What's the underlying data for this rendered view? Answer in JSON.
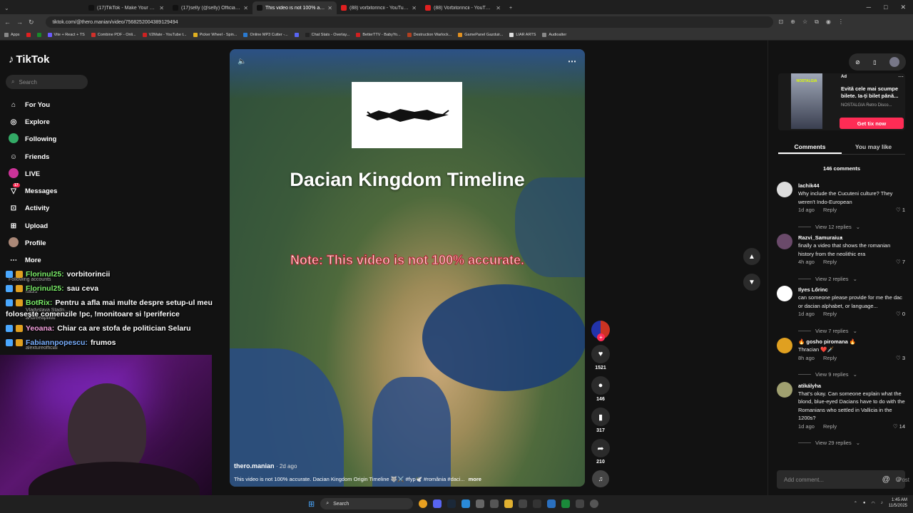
{
  "browser": {
    "tabs": [
      {
        "title": "(17)TikTok - Make Your Day",
        "color": "#111111"
      },
      {
        "title": "(17)selly (@selly) Official | TikTok",
        "color": "#111111"
      },
      {
        "title": "This video is not 100% accu...",
        "color": "#111111",
        "active": true
      },
      {
        "title": "(88) vorbitorincii - YouTube",
        "color": "#e02020"
      },
      {
        "title": "(88) Vorbitorincii - YouTube",
        "color": "#e02020"
      }
    ],
    "new_tab": "+",
    "url": "tiktok.com/@thero.manian/video/7568252004389129494",
    "bookmarks": [
      {
        "label": "Apps",
        "color": "#888888"
      },
      {
        "label": "",
        "color": "#e02020"
      },
      {
        "label": "",
        "color": "#1a8a2a"
      },
      {
        "label": "Vite + React + TS",
        "color": "#6b5bff"
      },
      {
        "label": "Combine PDF - Onli...",
        "color": "#d0302a"
      },
      {
        "label": "V2Mate - YouTube t...",
        "color": "#cc2222"
      },
      {
        "label": "Picker Wheel - Spin...",
        "color": "#e0b020"
      },
      {
        "label": "Online MP3 Cutter -...",
        "color": "#2a7ad0"
      },
      {
        "label": "",
        "color": "#5865f2"
      },
      {
        "label": "Chat Stats - Overlay...",
        "color": "#222222"
      },
      {
        "label": "BetterTTV - BabyYo...",
        "color": "#d02020"
      },
      {
        "label": "Destruction Warlock...",
        "color": "#b04020"
      },
      {
        "label": "GamePanel Gazduir...",
        "color": "#e09020"
      },
      {
        "label": "LIAR ARTS",
        "color": "#dddddd"
      },
      {
        "label": "Audioalter",
        "color": "#888888"
      }
    ]
  },
  "sidebar": {
    "logo": "TikTok",
    "search_placeholder": "Search",
    "items": [
      {
        "label": "For You",
        "icon": "home-icon",
        "glyph": "⌂"
      },
      {
        "label": "Explore",
        "icon": "compass-icon",
        "glyph": "◎"
      },
      {
        "label": "Following",
        "icon": "following-avatar-icon",
        "glyph": ""
      },
      {
        "label": "Friends",
        "icon": "friends-icon",
        "glyph": "☺"
      },
      {
        "label": "LIVE",
        "icon": "live-avatar-icon",
        "glyph": ""
      },
      {
        "label": "Messages",
        "icon": "messages-icon",
        "glyph": "▽",
        "badge": "17"
      },
      {
        "label": "Activity",
        "icon": "activity-icon",
        "glyph": "⊡"
      },
      {
        "label": "Upload",
        "icon": "upload-icon",
        "glyph": "⊞"
      },
      {
        "label": "Profile",
        "icon": "profile-avatar-icon",
        "glyph": ""
      },
      {
        "label": "More",
        "icon": "more-icon",
        "glyph": "⋯"
      }
    ]
  },
  "chat_overlay": [
    {
      "name": "Florinul25:",
      "message": "vorbitorincii",
      "name_color": "#7cf06a"
    },
    {
      "name": "Florinul25:",
      "message": "sau ceva",
      "name_color": "#7cf06a"
    },
    {
      "name": "BotRix:",
      "message": "Pentru a afla mai multe despre setup-ul meu",
      "name_color": "#7cf06a"
    },
    {
      "name": "",
      "message": "folosește comenzile !pc, !monitoare si !periferice",
      "name_color": "#7cf06a"
    },
    {
      "name": "Yeoana:",
      "message": "Chiar ca are stofa de politician Selaru",
      "name_color": "#f7a3e0"
    },
    {
      "name": "Fabiannpopescu:",
      "message": "frumos",
      "name_color": "#7ab0ff"
    }
  ],
  "faded_sidebar_text": {
    "following_accounts": "Following accounts",
    "users": [
      "iladiu",
      "Vladyslava Stadn...",
      "andreeapilitiu",
      "alextureofficial"
    ]
  },
  "video": {
    "title": "Dacian Kingdom Timeline",
    "note": "Note: This video is not 100% accurate.",
    "author": "thero.manian",
    "posted": "2d ago",
    "caption": "This video is not 100% accurate. Dacian Kingdom Origin Timeline 🐺⚔️ #fyp🕊️ #românia #daci...",
    "more": "more",
    "volume_icon": "🔈",
    "menu_icon": "⋯"
  },
  "actions": {
    "likes": "1521",
    "comments": "146",
    "saves": "317",
    "shares": "210"
  },
  "right_panel": {
    "ad": {
      "label": "Ad",
      "title": "Evită cele mai scumpe bilete. Ia-ți bilet până...",
      "sponsor": "NOSTALGIA Retro Disco...",
      "button": "Get tix now",
      "poster_text": "NOSTALGIA"
    },
    "tabs": [
      "Comments",
      "You may like"
    ],
    "comment_count": "146 comments",
    "comments": [
      {
        "user": "lachik44",
        "text": "Why include the Cucuteni culture? They weren't Indo-European",
        "time": "1d ago",
        "reply": "Reply",
        "likes": "1",
        "replies": "View 12 replies",
        "avatar": "#dddddd"
      },
      {
        "user": "Razvi_Samuraiuᴥ",
        "text": "finally a video that shows the romanian history from the neolithic era",
        "time": "4h ago",
        "reply": "Reply",
        "likes": "7",
        "replies": "View 2 replies",
        "avatar": "#6a4a6a"
      },
      {
        "user": "Ilyes Lőrinc",
        "text": "can someone please provide for me the dac or dacian alphabet, or language...",
        "time": "1d ago",
        "reply": "Reply",
        "likes": "0",
        "replies": "View 7 replies",
        "avatar": "#ffffff"
      },
      {
        "user": "🔥 gosho piromana 🔥",
        "text": "Thracian ❤️🗡️",
        "time": "8h ago",
        "reply": "Reply",
        "likes": "3",
        "replies": "View 9 replies",
        "avatar": "#e0a020"
      },
      {
        "user": "atikályha",
        "text": "That's okay. Can someone explain what the blond, blue-eyed Dacians have to do with the Romanians who settled in Vallicia in the 1200s?",
        "time": "1d ago",
        "reply": "Reply",
        "likes": "14",
        "replies": "View 29 replies",
        "avatar": "#a0a070"
      }
    ],
    "add_comment_placeholder": "Add comment...",
    "post": "Post"
  },
  "taskbar": {
    "search": "Search",
    "time": "1:45 AM",
    "date": "11/5/2025"
  },
  "colors": {
    "accent": "#fe2c55",
    "background": "#121212"
  }
}
